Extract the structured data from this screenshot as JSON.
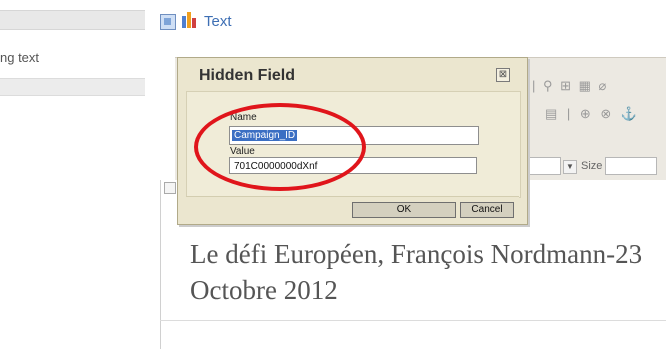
{
  "sidebar": {
    "item_label": "ng text"
  },
  "top": {
    "text_link": "Text"
  },
  "toolbar": {
    "size_label": "Size"
  },
  "dialog": {
    "title": "Hidden Field",
    "close_glyph": "⊠",
    "name_label": "Name",
    "name_value": "Campaign_ID",
    "value_label": "Value",
    "value_value": "701C0000000dXnf",
    "ok_label": "OK",
    "cancel_label": "Cancel"
  },
  "editor": {
    "content": "Le défi Européen, François Nordmann-23 Octobre 2012"
  },
  "colors": {
    "annotation": "#e0151b",
    "selection": "#3b6fc3",
    "link": "#3e6fb4"
  }
}
